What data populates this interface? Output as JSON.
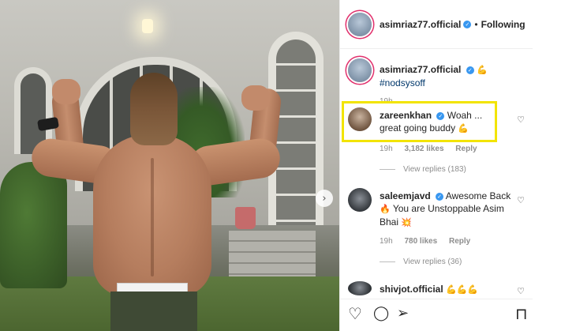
{
  "post": {
    "author": "asimriaz77.official",
    "follow_status": "Following",
    "separator": "•"
  },
  "caption": {
    "username": "asimriaz77.official",
    "emoji": "💪",
    "hashtag": "#nodsysoff",
    "time": "19h"
  },
  "comments": [
    {
      "username": "zareenkhan",
      "text": "Woah ... great going buddy",
      "emoji": "💪",
      "time": "19h",
      "likes": "3,182 likes",
      "reply": "Reply",
      "view_replies": "View replies (183)"
    },
    {
      "username": "saleemjavd",
      "text": "Awesome Back",
      "emoji": "🔥",
      "text2": "You are Unstoppable Asim Bhai",
      "emoji2": "💥",
      "time": "19h",
      "likes": "780 likes",
      "reply": "Reply",
      "view_replies": "View replies (36)"
    },
    {
      "username": "shivjot.official",
      "emoji": "💪💪💪"
    }
  ],
  "icons": {
    "verified": "verified-badge",
    "heart": "heart-icon",
    "comment": "comment-icon",
    "share": "share-icon",
    "save": "bookmark-icon",
    "next": "chevron-right-icon"
  },
  "glyphs": {
    "verified": "✓",
    "heart_small": "♡",
    "next": "›",
    "like": "♡",
    "comment": "◯",
    "share": "➢",
    "save": "⊓"
  },
  "colors": {
    "highlight": "#f2e400",
    "verified": "#3897f0",
    "hashtag": "#00376b",
    "muted": "#8e8e8e"
  }
}
